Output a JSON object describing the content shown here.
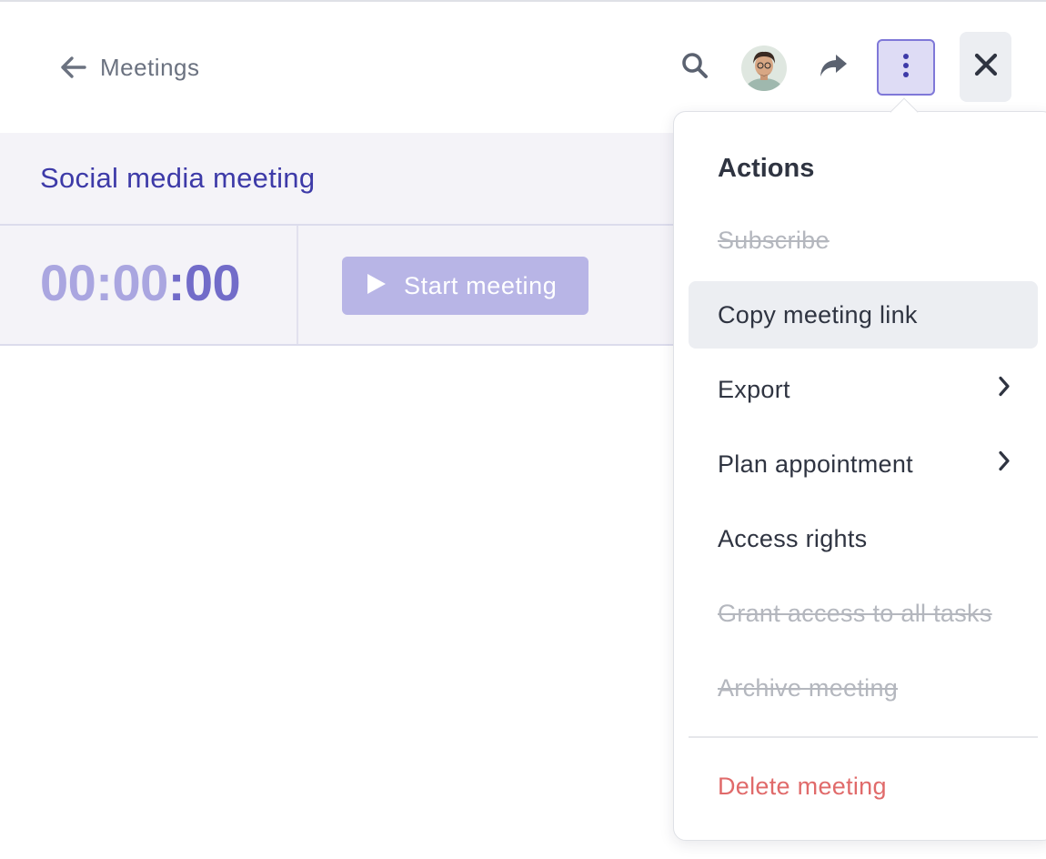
{
  "header": {
    "back_label": "Meetings"
  },
  "meeting": {
    "title": "Social media meeting",
    "timer_hours_minutes": "00:00",
    "timer_seconds": ":00",
    "start_label": "Start meeting"
  },
  "menu": {
    "heading": "Actions",
    "items": [
      {
        "label": "Subscribe",
        "disabled": true
      },
      {
        "label": "Copy meeting link",
        "disabled": false
      },
      {
        "label": "Export",
        "disabled": false,
        "submenu": true
      },
      {
        "label": "Plan appointment",
        "disabled": false,
        "submenu": true
      },
      {
        "label": "Access rights",
        "disabled": false
      },
      {
        "label": "Grant access to all tasks",
        "disabled": true
      },
      {
        "label": "Archive meeting",
        "disabled": true
      }
    ],
    "danger_item": "Delete meeting"
  },
  "icons": {
    "back": "arrow-left-icon",
    "search": "search-icon",
    "share": "share-forward-icon",
    "more": "more-vertical-icon",
    "close": "close-icon",
    "play": "play-icon",
    "chevron": "chevron-right-icon"
  },
  "colors": {
    "accent": "#3d3aa8",
    "timer_faded": "#aaa6e0",
    "timer_strong": "#726cc9",
    "start_button": "#b8b5e6",
    "danger": "#e06a6a",
    "disabled_text": "#b4b7be"
  }
}
